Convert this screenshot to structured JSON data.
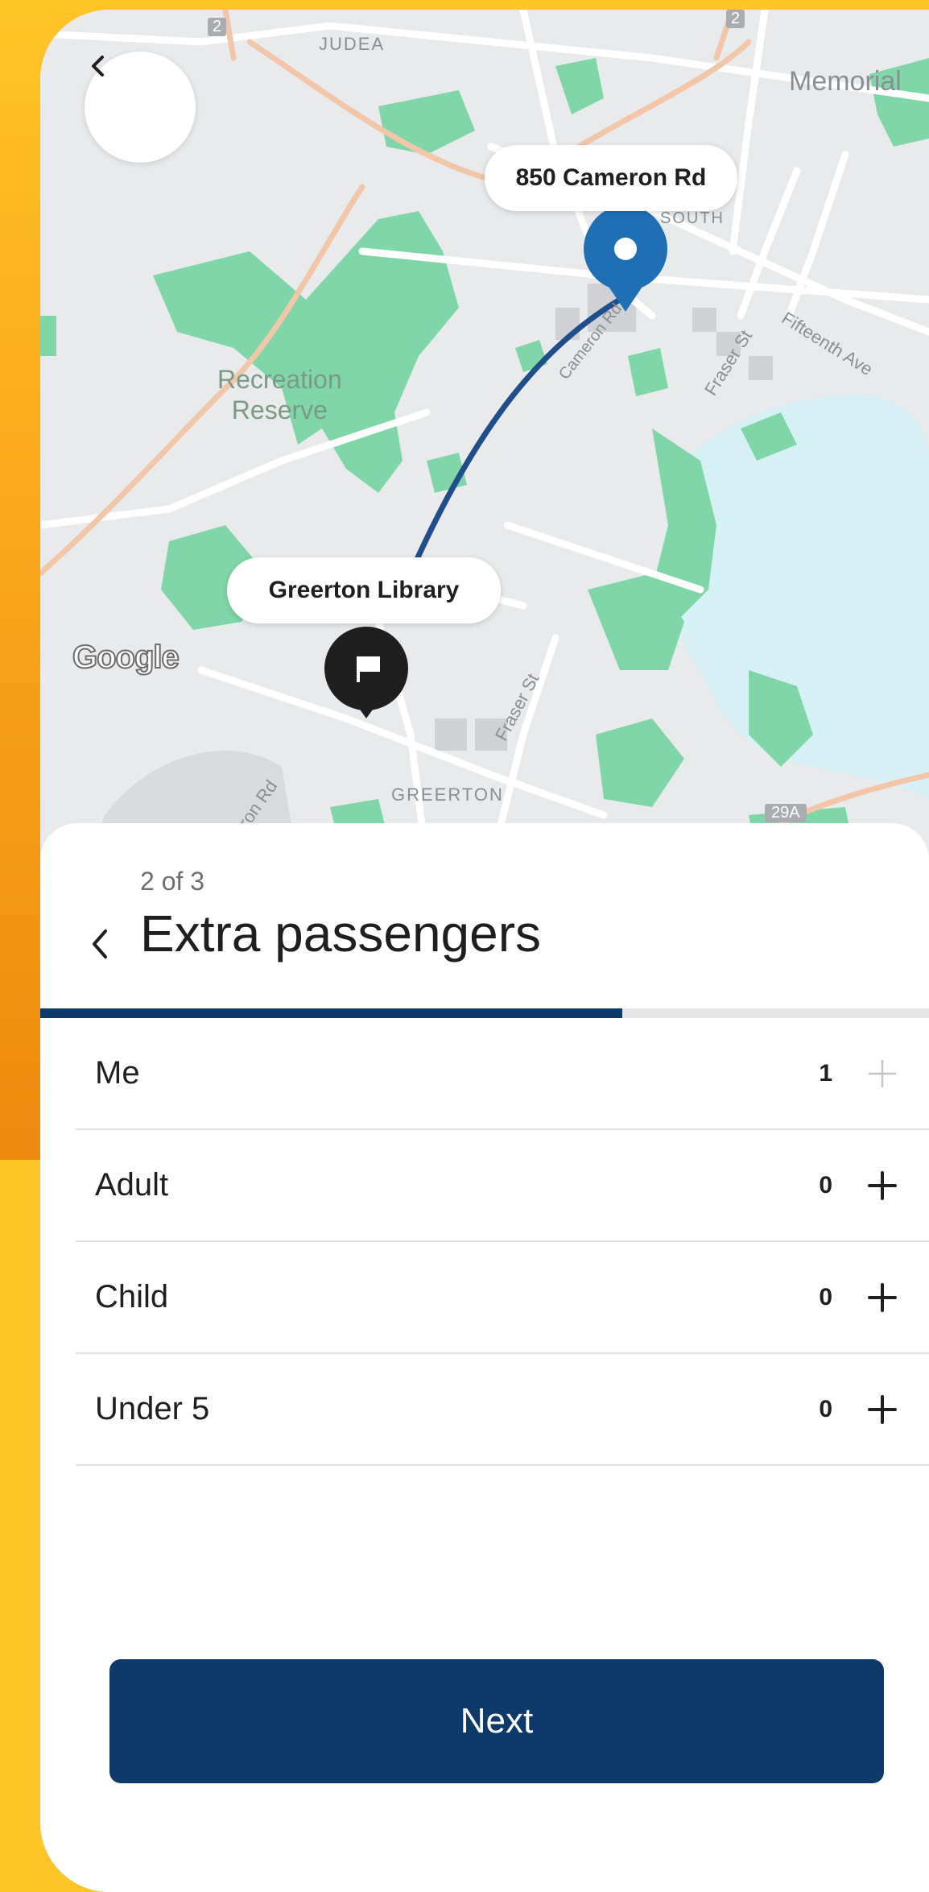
{
  "map": {
    "labels": {
      "judea": "JUDEA",
      "memorial": "Memorial",
      "south": "SOUTH",
      "fifteenth_ave": "Fifteenth Ave",
      "fraser_st_top": "Fraser St",
      "cameron_rd_road": "Cameron Rd",
      "recreation_reserve": "Recreation\nReserve",
      "fraser_st_bottom": "Fraser St",
      "cameron_rd_bottom": "eron Rd",
      "greerton": "GREERTON",
      "road_2a": "2",
      "road_2b": "2",
      "road_29a": "29A"
    },
    "origin_callout": "850 Cameron Rd",
    "destination_callout": "Greerton Library",
    "google_logo": "Google",
    "route_color": "#1E4E8C",
    "origin_pin_color": "#1F6FB5",
    "destination_pin_color": "#1f1f1f",
    "park_color": "#7FD7A7",
    "water_color": "#D6F0F6"
  },
  "sheet": {
    "step": "2 of 3",
    "title": "Extra passengers",
    "progress": 0.655,
    "rows": [
      {
        "label": "Me",
        "count": "1",
        "plus_enabled": false
      },
      {
        "label": "Adult",
        "count": "0",
        "plus_enabled": true
      },
      {
        "label": "Child",
        "count": "0",
        "plus_enabled": true
      },
      {
        "label": "Under 5",
        "count": "0",
        "plus_enabled": true
      }
    ],
    "next_label": "Next"
  },
  "colors": {
    "brand_navy": "#0D3A6B",
    "background_yellow": "#FFC426",
    "background_orange": "#EE8A10"
  }
}
